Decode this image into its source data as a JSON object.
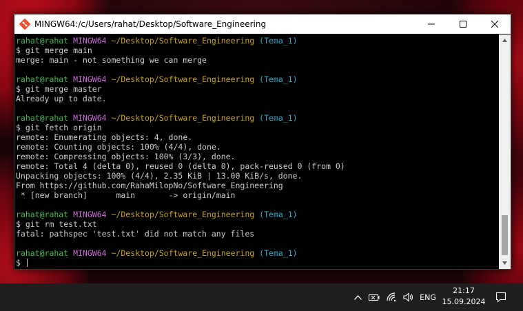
{
  "window": {
    "title": "MINGW64:/c/Users/rahat/Desktop/Software_Engineering"
  },
  "terminal": {
    "lines": [
      {
        "type": "prompt",
        "user": "rahat@rahat",
        "shell": "MINGW64",
        "path": "~/Desktop/Software_Engineering",
        "branch": "(Tema_1)"
      },
      {
        "type": "text",
        "text": "$ git merge main"
      },
      {
        "type": "text",
        "text": "merge: main - not something we can merge"
      },
      {
        "type": "blank",
        "text": ""
      },
      {
        "type": "prompt",
        "user": "rahat@rahat",
        "shell": "MINGW64",
        "path": "~/Desktop/Software_Engineering",
        "branch": "(Tema_1)"
      },
      {
        "type": "text",
        "text": "$ git merge master"
      },
      {
        "type": "text",
        "text": "Already up to date."
      },
      {
        "type": "blank",
        "text": ""
      },
      {
        "type": "prompt",
        "user": "rahat@rahat",
        "shell": "MINGW64",
        "path": "~/Desktop/Software_Engineering",
        "branch": "(Tema_1)"
      },
      {
        "type": "text",
        "text": "$ git fetch origin"
      },
      {
        "type": "text",
        "text": "remote: Enumerating objects: 4, done."
      },
      {
        "type": "text",
        "text": "remote: Counting objects: 100% (4/4), done."
      },
      {
        "type": "text",
        "text": "remote: Compressing objects: 100% (3/3), done."
      },
      {
        "type": "text",
        "text": "remote: Total 4 (delta 0), reused 0 (delta 0), pack-reused 0 (from 0)"
      },
      {
        "type": "text",
        "text": "Unpacking objects: 100% (4/4), 2.35 KiB | 13.00 KiB/s, done."
      },
      {
        "type": "text",
        "text": "From https://github.com/RahaMilopNo/Software_Engineering"
      },
      {
        "type": "text",
        "text": " * [new branch]      main       -> origin/main"
      },
      {
        "type": "blank",
        "text": ""
      },
      {
        "type": "prompt",
        "user": "rahat@rahat",
        "shell": "MINGW64",
        "path": "~/Desktop/Software_Engineering",
        "branch": "(Tema_1)"
      },
      {
        "type": "text",
        "text": "$ git rm test.txt"
      },
      {
        "type": "text",
        "text": "fatal: pathspec 'test.txt' did not match any files"
      },
      {
        "type": "blank",
        "text": ""
      },
      {
        "type": "prompt",
        "user": "rahat@rahat",
        "shell": "MINGW64",
        "path": "~/Desktop/Software_Engineering",
        "branch": "(Tema_1)"
      },
      {
        "type": "input",
        "text": "$ "
      }
    ]
  },
  "taskbar": {
    "language": "ENG",
    "time": "21:17",
    "date": "15.09.2024"
  },
  "colors": {
    "prompt_user": "#3fb950",
    "prompt_shell": "#c86ed4",
    "prompt_path": "#c7a21a",
    "prompt_branch": "#2fa8c8",
    "terminal_text": "#c0c0c0"
  }
}
